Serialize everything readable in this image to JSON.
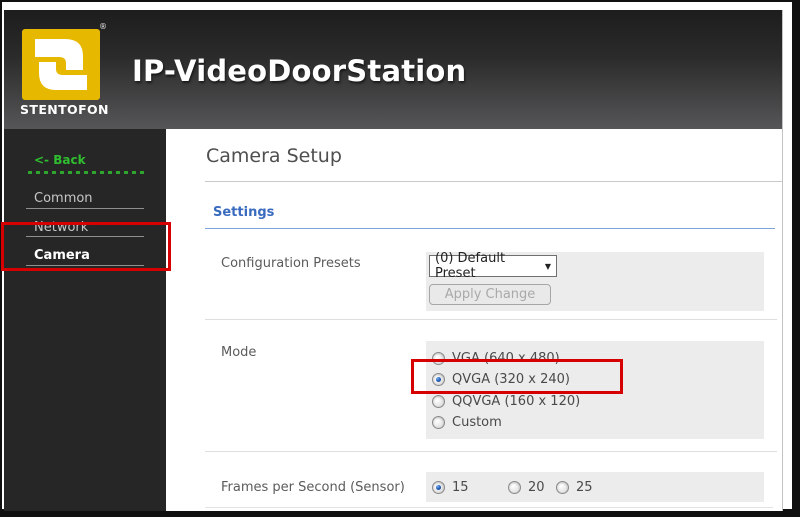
{
  "header": {
    "title": "IP-VideoDoorStation",
    "logo": {
      "brand": "STENTOFON",
      "registered_mark": "®"
    }
  },
  "sidebar": {
    "back_label": "<- Back",
    "items": [
      {
        "label": "Common",
        "active": false
      },
      {
        "label": "Network",
        "active": false
      },
      {
        "label": "Camera",
        "active": true
      }
    ]
  },
  "main": {
    "page_title": "Camera Setup",
    "section_title": "Settings",
    "rows": [
      {
        "label": "Configuration Presets",
        "select_value": "(0) Default Preset",
        "button_label": "Apply Change",
        "button_enabled": false
      },
      {
        "label": "Mode",
        "options": [
          {
            "label": "VGA (640 x 480)",
            "selected": false
          },
          {
            "label": "QVGA (320 x 240)",
            "selected": true
          },
          {
            "label": "QQVGA (160 x 120)",
            "selected": false
          },
          {
            "label": "Custom",
            "selected": false
          }
        ]
      },
      {
        "label": "Frames per Second (Sensor)",
        "options": [
          {
            "label": "15",
            "selected": true
          },
          {
            "label": "20",
            "selected": false
          },
          {
            "label": "25",
            "selected": false
          }
        ]
      }
    ]
  },
  "icons": {
    "dropdown_arrow": "▼"
  },
  "annotations": {
    "color": "#d60000",
    "highlighted_sidebar_item": "Camera",
    "highlighted_option": "QVGA (320 x 240)"
  },
  "colors": {
    "logo_yellow": "#e6b800",
    "back_green": "#2fbe2f",
    "section_blue": "#3a6bbf",
    "annotation_red": "#d60000",
    "sidebar_bg": "#262626",
    "panel_gray": "#ececec"
  }
}
